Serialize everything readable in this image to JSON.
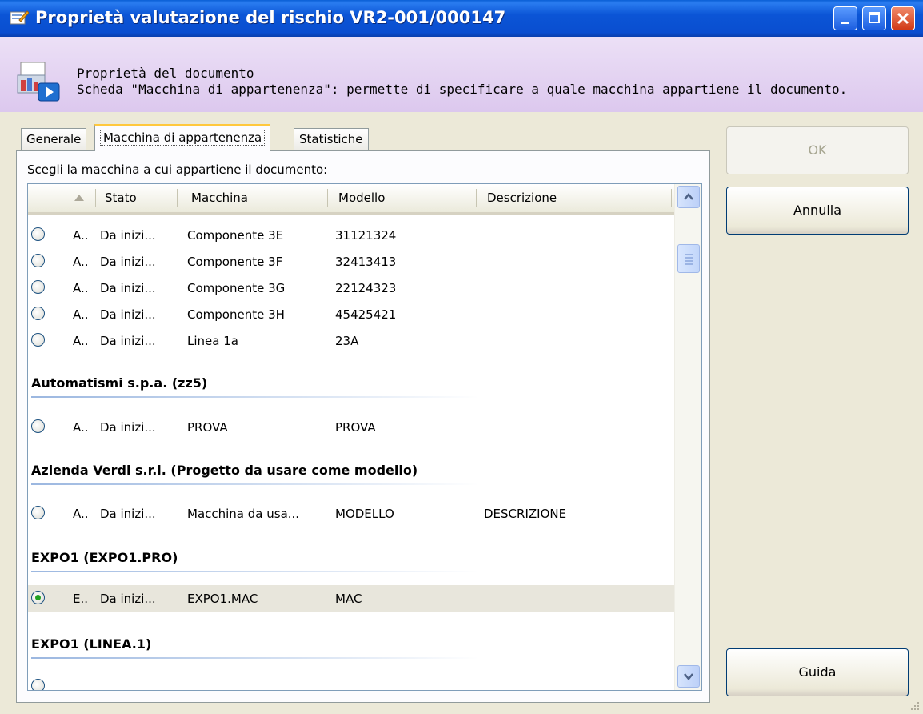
{
  "window": {
    "title": "Proprietà valutazione del rischio VR2-001/000147"
  },
  "header": {
    "title": "Proprietà del documento",
    "description": "Scheda \"Macchina di appartenenza\": permette di specificare a quale macchina appartiene il documento."
  },
  "tabs": [
    {
      "label": "Generale"
    },
    {
      "label": "Macchina di appartenenza"
    },
    {
      "label": "Statistiche"
    }
  ],
  "panel": {
    "instruction": "Scegli la macchina a cui appartiene il documento:"
  },
  "list": {
    "columns": [
      "Stato",
      "Macchina",
      "Modello",
      "Descrizione"
    ],
    "groups": [
      {
        "name": "Automatismi s.p.a. (zz5)"
      },
      {
        "name": "Azienda Verdi s.r.l. (Progetto da usare come modello)"
      },
      {
        "name": "EXPO1 (EXPO1.PRO)"
      },
      {
        "name": "EXPO1 (LINEA.1)"
      }
    ],
    "rows": [
      {
        "code": "A..",
        "stato": "Da inizi...",
        "macchina": "Componente 3E",
        "modello": "31121324",
        "descrizione": ""
      },
      {
        "code": "A..",
        "stato": "Da inizi...",
        "macchina": "Componente 3F",
        "modello": "32413413",
        "descrizione": ""
      },
      {
        "code": "A..",
        "stato": "Da inizi...",
        "macchina": "Componente 3G",
        "modello": "22124323",
        "descrizione": ""
      },
      {
        "code": "A..",
        "stato": "Da inizi...",
        "macchina": "Componente 3H",
        "modello": "45425421",
        "descrizione": ""
      },
      {
        "code": "A..",
        "stato": "Da inizi...",
        "macchina": "Linea 1a",
        "modello": "23A",
        "descrizione": ""
      },
      {
        "code": "A..",
        "stato": "Da inizi...",
        "macchina": "PROVA",
        "modello": "PROVA",
        "descrizione": ""
      },
      {
        "code": "A..",
        "stato": "Da inizi...",
        "macchina": "Macchina da usa...",
        "modello": "MODELLO",
        "descrizione": "DESCRIZIONE"
      },
      {
        "code": "E..",
        "stato": "Da inizi...",
        "macchina": "EXPO1.MAC",
        "modello": "MAC",
        "descrizione": "",
        "selected": true
      }
    ]
  },
  "buttons": {
    "ok": "OK",
    "annulla": "Annulla",
    "guida": "Guida"
  },
  "colors": {
    "titlebar": "#0a55d6",
    "header_band": "#e4d4f2",
    "dialog_bg": "#ece9d8",
    "selected_row": "#e8e6dc",
    "radio_dot": "#21a121"
  }
}
